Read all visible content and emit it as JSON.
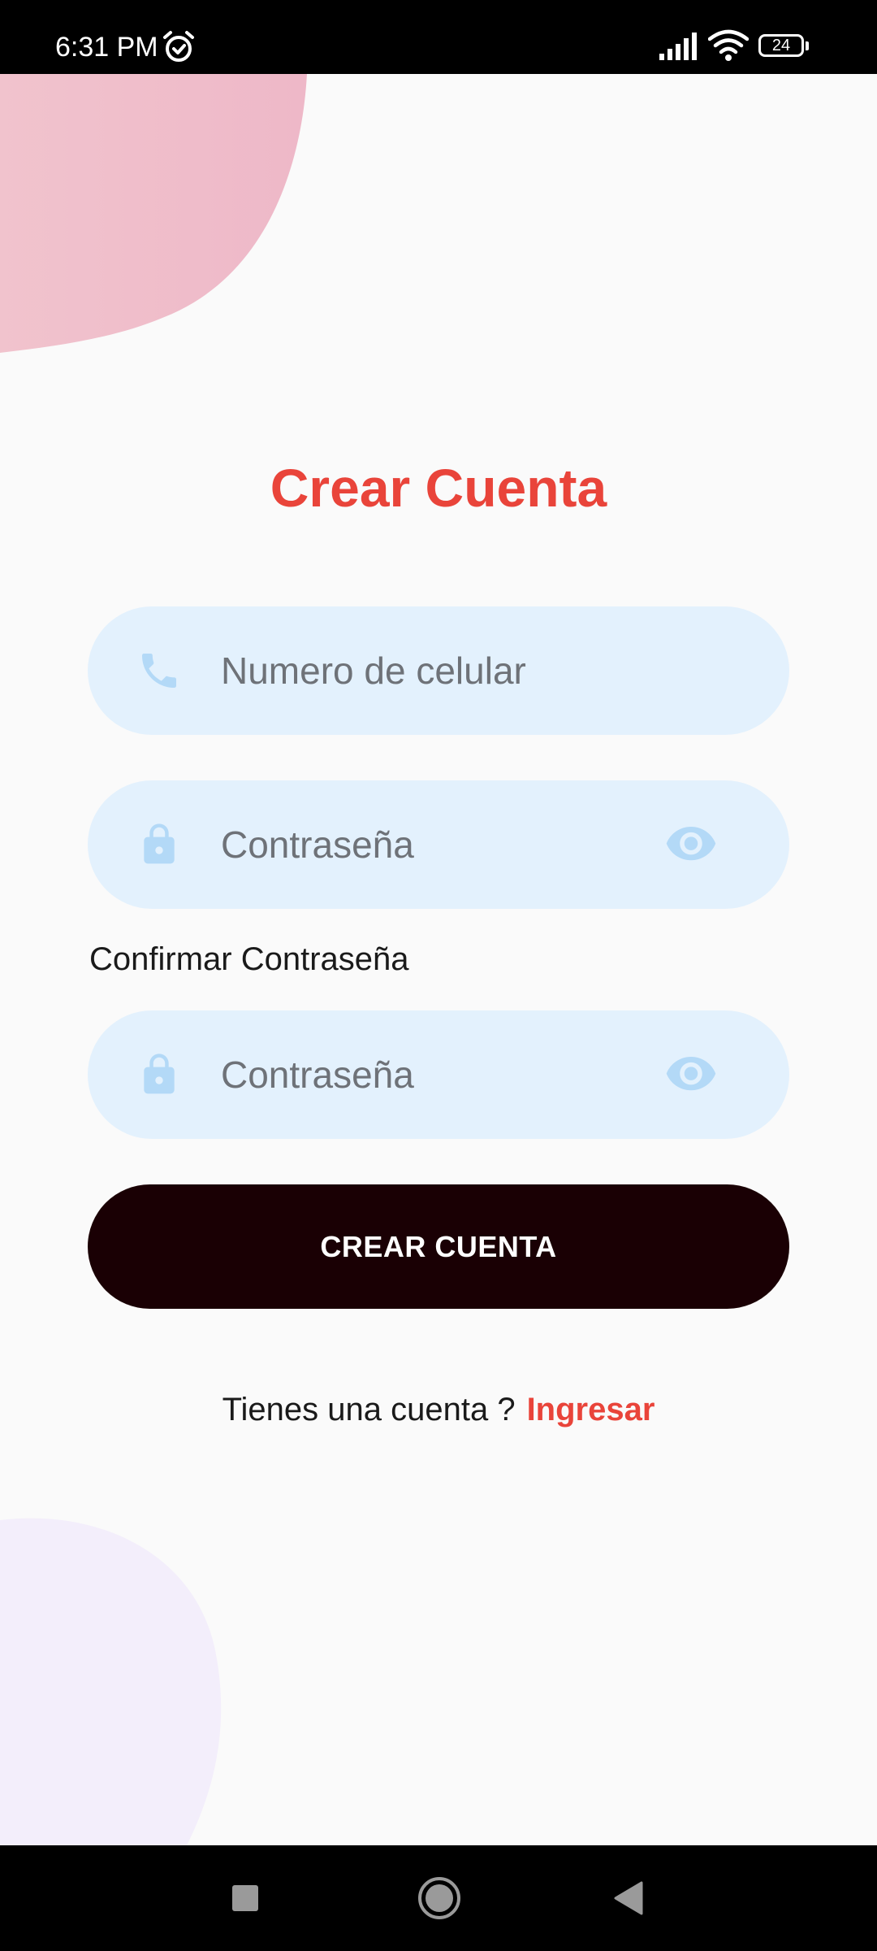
{
  "status_bar": {
    "time": "6:31 PM",
    "battery_level": "24",
    "icons": [
      "alarm-icon",
      "signal-icon",
      "wifi-icon",
      "battery-icon"
    ]
  },
  "title": "Crear Cuenta",
  "phone_field": {
    "placeholder": "Numero de celular",
    "value": "",
    "icon": "phone-icon"
  },
  "password_field": {
    "placeholder": "Contraseña",
    "value": "",
    "icon": "lock-icon",
    "toggle_icon": "eye-icon"
  },
  "confirm_label": "Confirmar Contraseña",
  "confirm_password_field": {
    "placeholder": "Contraseña",
    "value": "",
    "icon": "lock-icon",
    "toggle_icon": "eye-icon"
  },
  "create_button_label": "CREAR CUENTA",
  "signin": {
    "prompt": "Tienes una cuenta ?",
    "link": "Ingresar"
  },
  "colors": {
    "accent": "#e9443a",
    "button": "#1a0004",
    "field_bg": "#e3f1fd",
    "icon_tint": "#b3d9f7",
    "blob_pink": "#efbfca",
    "blob_lavender": "#f3eefb"
  },
  "nav_bar": {
    "icons": [
      "recents-icon",
      "home-icon",
      "back-icon"
    ]
  }
}
